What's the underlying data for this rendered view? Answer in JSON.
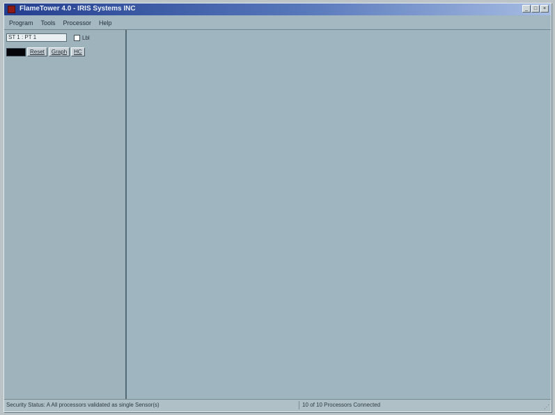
{
  "window": {
    "title": "FlameTower 4.0 - IRIS Systems INC",
    "controls": {
      "minimize": "_",
      "maximize": "□",
      "close": "×"
    }
  },
  "menu": {
    "items": [
      "Program",
      "Tools",
      "Processor",
      "Help"
    ]
  },
  "sidebar": {
    "pt_select": "ST 1 : PT 1",
    "checkbox_label": "Lbl",
    "checkbox_checked": false,
    "swatch_color": "#06060a",
    "buttons": [
      "Reset",
      "Graph",
      "HC"
    ]
  },
  "status": {
    "security": "Security Status: A  All processors validated as single Sensor(s)",
    "processors": "10 of 10 Processors Connected"
  },
  "colors": {
    "title_gradient_start": "#233e8f",
    "workspace": "#9fb5bf"
  }
}
